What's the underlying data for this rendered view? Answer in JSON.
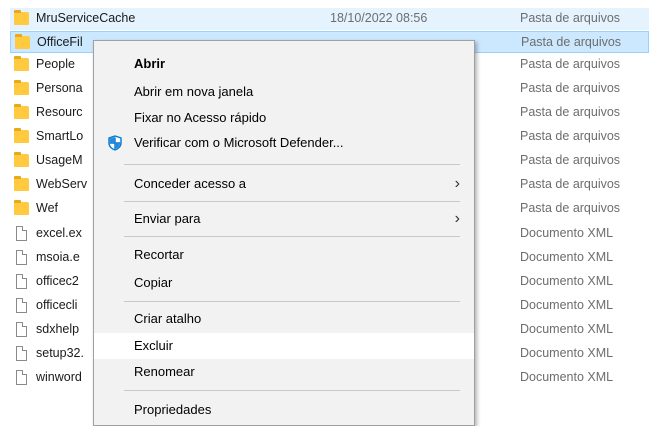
{
  "files": [
    {
      "name": "MruServiceCache",
      "date": "18/10/2022 08:56",
      "type": "Pasta de arquivos",
      "icon": "folder-icon",
      "state": "hover"
    },
    {
      "name": "OfficeFil",
      "date": "",
      "type": "Pasta de arquivos",
      "icon": "folder-icon",
      "state": "selected"
    },
    {
      "name": "People",
      "date": "",
      "type": "Pasta de arquivos",
      "icon": "folder-icon"
    },
    {
      "name": "Persona",
      "date": "",
      "type": "Pasta de arquivos",
      "icon": "folder-icon"
    },
    {
      "name": "Resourc",
      "date": "",
      "type": "Pasta de arquivos",
      "icon": "folder-icon"
    },
    {
      "name": "SmartLo",
      "date": "",
      "type": "Pasta de arquivos",
      "icon": "folder-icon"
    },
    {
      "name": "UsageM",
      "date": "",
      "type": "Pasta de arquivos",
      "icon": "folder-icon"
    },
    {
      "name": "WebServ",
      "date": "",
      "type": "Pasta de arquivos",
      "icon": "folder-icon"
    },
    {
      "name": "Wef",
      "date": "",
      "type": "Pasta de arquivos",
      "icon": "folder-icon"
    },
    {
      "name": "excel.ex",
      "date": "",
      "type": "Documento XML",
      "icon": "document-icon"
    },
    {
      "name": "msoia.e",
      "date": "",
      "type": "Documento XML",
      "icon": "document-icon"
    },
    {
      "name": "officec2",
      "date": "",
      "type": "Documento XML",
      "icon": "document-icon"
    },
    {
      "name": "officecli",
      "date": "",
      "type": "Documento XML",
      "icon": "document-icon"
    },
    {
      "name": "sdxhelp",
      "date": "",
      "type": "Documento XML",
      "icon": "document-icon"
    },
    {
      "name": "setup32.",
      "date": "",
      "type": "Documento XML",
      "icon": "document-icon"
    },
    {
      "name": "winword",
      "date": "",
      "type": "Documento XML",
      "icon": "document-icon"
    }
  ],
  "context_menu": {
    "items": [
      {
        "label": "Abrir",
        "bold": true
      },
      {
        "label": "Abrir em nova janela"
      },
      {
        "label": "Fixar no Acesso rápido"
      },
      {
        "label": "Verificar com o Microsoft Defender...",
        "icon": "defender-shield-icon"
      },
      {
        "label": "Conceder acesso a",
        "submenu": true
      },
      {
        "label": "Enviar para",
        "submenu": true
      },
      {
        "label": "Recortar"
      },
      {
        "label": "Copiar"
      },
      {
        "label": "Criar atalho"
      },
      {
        "label": "Excluir",
        "highlighted": true
      },
      {
        "label": "Renomear"
      },
      {
        "label": "Propriedades"
      }
    ],
    "submenu_arrow": "›"
  },
  "colors": {
    "folder": "#ffc940",
    "selection": "#cce8ff",
    "hover": "#e5f3ff",
    "shield": "#0078d4"
  }
}
